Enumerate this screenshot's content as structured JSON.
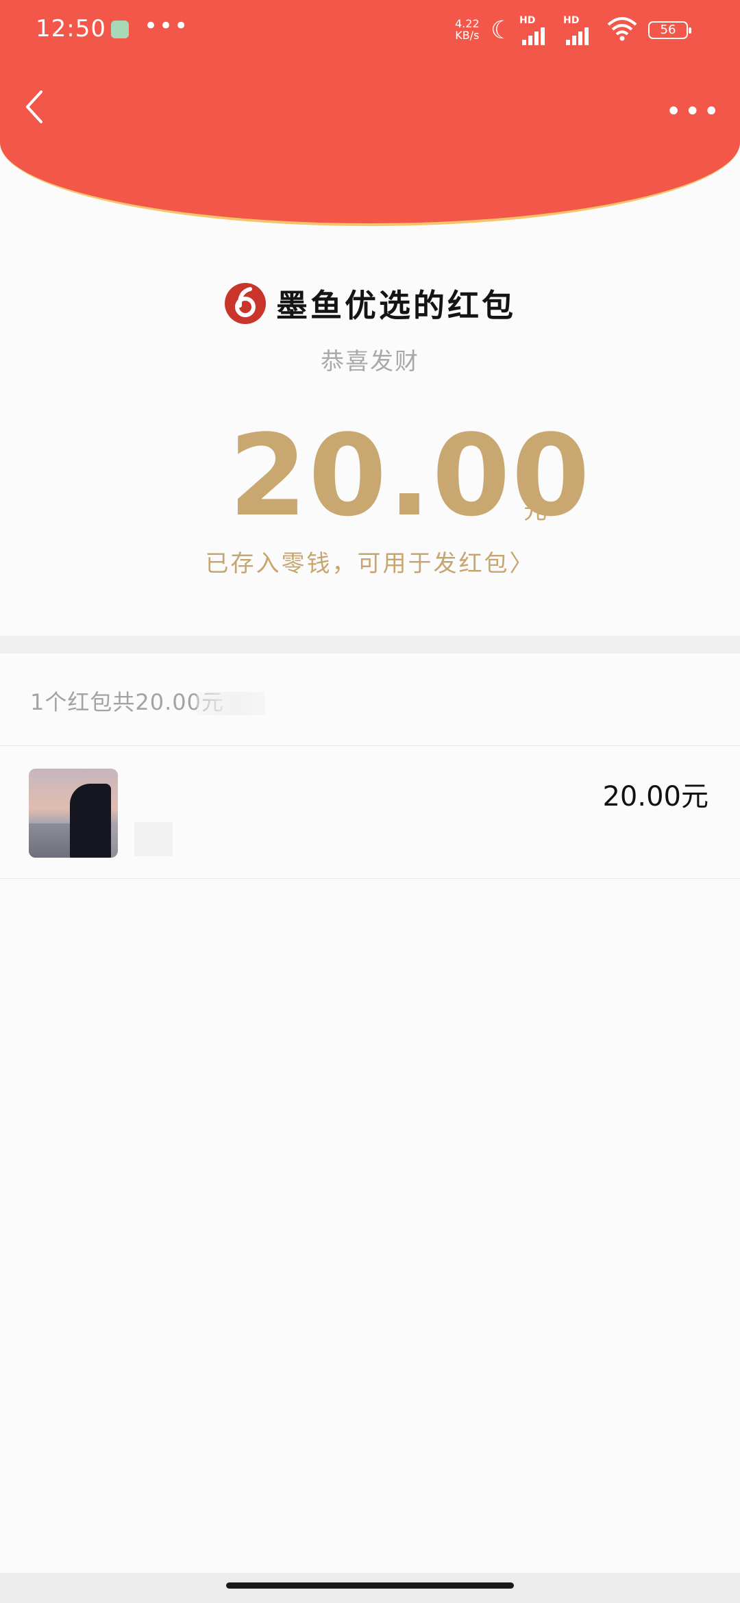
{
  "status_bar": {
    "time": "12:50",
    "overflow": "•••",
    "net_speed_value": "4.22",
    "net_speed_unit": "KB/s",
    "sim1_label": "HD",
    "sim2_label": "HD",
    "battery": "56"
  },
  "nav": {
    "back_icon": "chevron-left-icon",
    "more_label": "•••"
  },
  "header": {
    "title": "墨鱼优选的红包",
    "greeting": "恭喜发财",
    "amount": "20.00",
    "amount_unit": "元",
    "stored_text": "已存入零钱，可用于发红包",
    "stored_chevron": "〉"
  },
  "summary": {
    "text": "1个红包共20.00元"
  },
  "records": [
    {
      "amount": "20.00元"
    }
  ],
  "colors": {
    "header_red": "#f35749",
    "header_border": "#f5c46b",
    "gold": "#c8a771",
    "logo_red": "#c9352b"
  }
}
